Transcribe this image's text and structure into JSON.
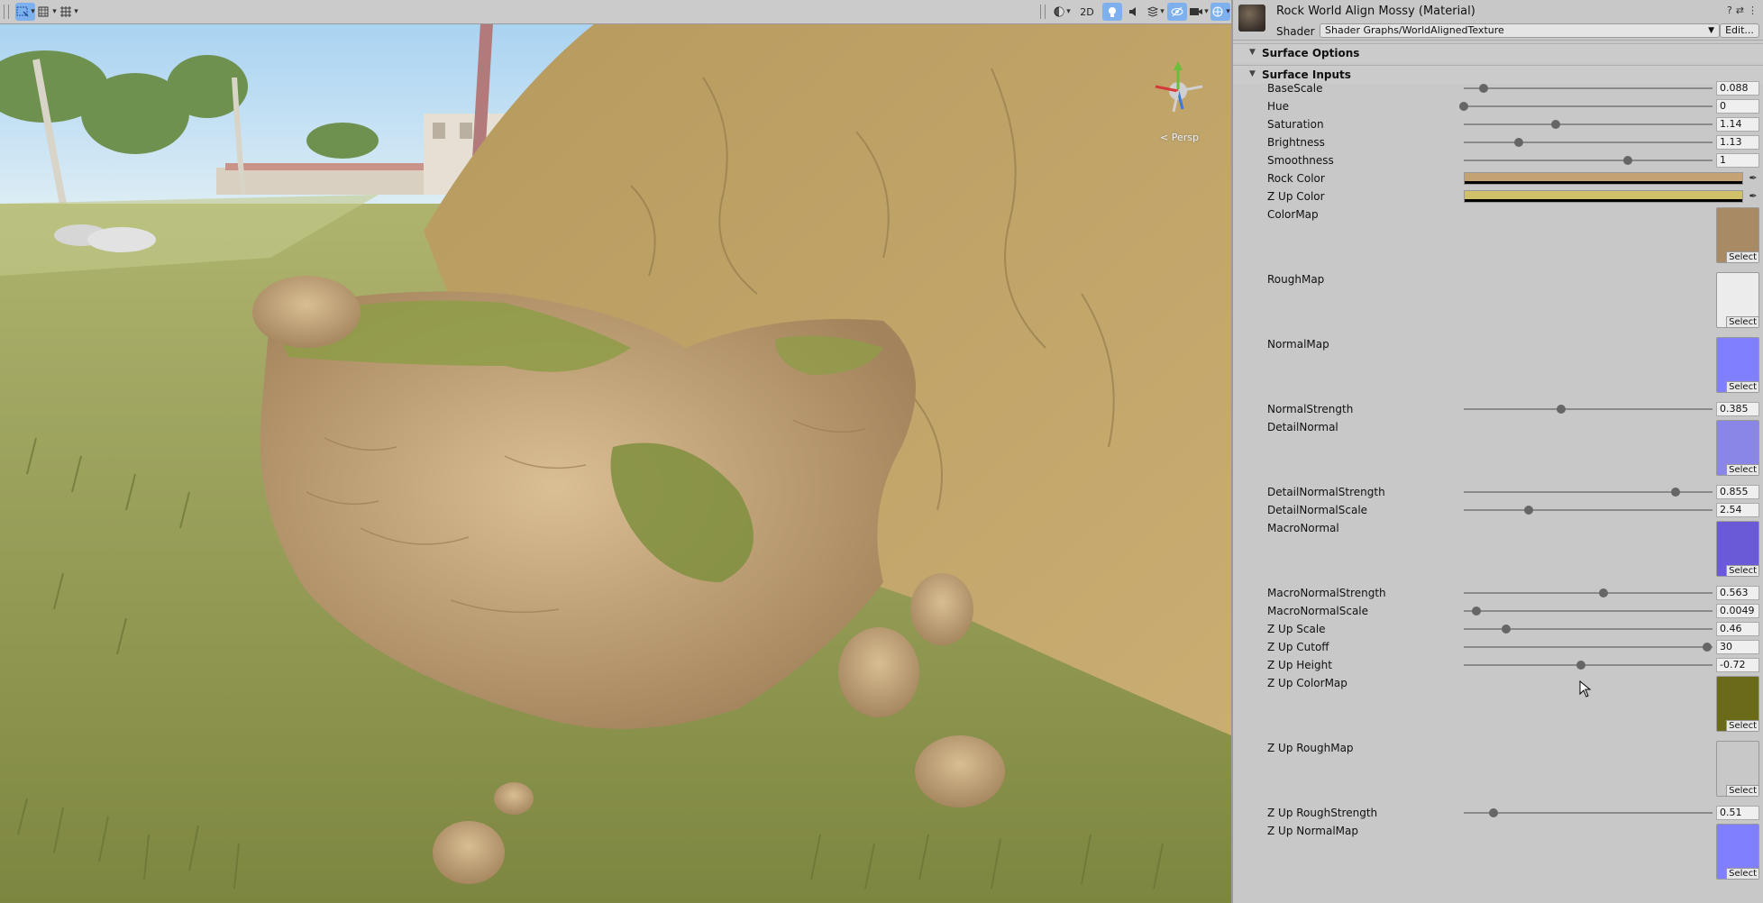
{
  "toolbar": {
    "left_buttons": [
      {
        "icon": "rect-select-icon",
        "active": true
      },
      {
        "icon": "transform-tools-icon",
        "active": false
      },
      {
        "icon": "grid-snap-icon",
        "active": false
      }
    ],
    "right_buttons": [
      {
        "icon": "shading-mode-icon"
      },
      {
        "label": "2D"
      },
      {
        "icon": "lighting-icon",
        "active": true
      },
      {
        "icon": "audio-icon"
      },
      {
        "icon": "effects-icon"
      },
      {
        "icon": "hidden-objects-icon",
        "active": true
      },
      {
        "icon": "camera-icon"
      },
      {
        "icon": "gizmos-icon",
        "active": true
      }
    ]
  },
  "scene": {
    "persp_label": "< Persp",
    "gizmo_axes": [
      "y-axis-green",
      "x-axis-red",
      "z-axis-blue"
    ]
  },
  "inspector": {
    "material_title": "Rock World Align Mossy (Material)",
    "shader_label": "Shader",
    "shader_value": "Shader Graphs/WorldAlignedTexture",
    "edit_label": "Edit...",
    "header_icons": [
      "help-icon",
      "settings-icon",
      "more-icon"
    ],
    "sections": [
      {
        "title": "Surface Options",
        "expanded": false
      },
      {
        "title": "Surface Inputs",
        "expanded": true
      }
    ],
    "properties": [
      {
        "label": "BaseScale",
        "type": "slider",
        "value": "0.088",
        "fraction": 0.08
      },
      {
        "label": "Hue",
        "type": "slider",
        "value": "0",
        "fraction": 0.0
      },
      {
        "label": "Saturation",
        "type": "slider",
        "value": "1.14",
        "fraction": 0.37
      },
      {
        "label": "Brightness",
        "type": "slider",
        "value": "1.13",
        "fraction": 0.22
      },
      {
        "label": "Smoothness",
        "type": "slider",
        "value": "1",
        "fraction": 0.66
      },
      {
        "label": "Rock Color",
        "type": "color",
        "color": "#c4a274"
      },
      {
        "label": "Z Up Color",
        "type": "color",
        "color": "#d1c06a"
      },
      {
        "label": "ColorMap",
        "type": "texture",
        "swatch": "#a88a64",
        "select": "Select"
      },
      {
        "label": "RoughMap",
        "type": "texture",
        "swatch": "#ececec",
        "select": "Select"
      },
      {
        "label": "NormalMap",
        "type": "texture",
        "swatch": "#8080ff",
        "select": "Select"
      },
      {
        "label": "NormalStrength",
        "type": "slider",
        "value": "0.385",
        "fraction": 0.39
      },
      {
        "label": "DetailNormal",
        "type": "texture",
        "swatch": "#8a86e8",
        "select": "Select"
      },
      {
        "label": "DetailNormalStrength",
        "type": "slider",
        "value": "0.855",
        "fraction": 0.85
      },
      {
        "label": "DetailNormalScale",
        "type": "slider",
        "value": "2.54",
        "fraction": 0.26
      },
      {
        "label": "MacroNormal",
        "type": "texture",
        "swatch": "#6a5ad8",
        "select": "Select"
      },
      {
        "label": "MacroNormalStrength",
        "type": "slider",
        "value": "0.563",
        "fraction": 0.56
      },
      {
        "label": "MacroNormalScale",
        "type": "slider",
        "value": "0.0049",
        "fraction": 0.05
      },
      {
        "label": "Z Up Scale",
        "type": "slider",
        "value": "0.46",
        "fraction": 0.17
      },
      {
        "label": "Z Up Cutoff",
        "type": "slider",
        "value": "30",
        "fraction": 0.98
      },
      {
        "label": "Z Up Height",
        "type": "slider",
        "value": "-0.72",
        "fraction": 0.47
      },
      {
        "label": "Z Up ColorMap",
        "type": "texture",
        "swatch": "#6b6a18",
        "select": "Select"
      },
      {
        "label": "Z Up RoughMap",
        "type": "texture",
        "swatch": "#c8c8c8",
        "select": "Select"
      },
      {
        "label": "Z Up RoughStrength",
        "type": "slider",
        "value": "0.51",
        "fraction": 0.12
      },
      {
        "label": "Z Up NormalMap",
        "type": "texture",
        "swatch": "#8080ff",
        "select": "Select"
      }
    ]
  }
}
